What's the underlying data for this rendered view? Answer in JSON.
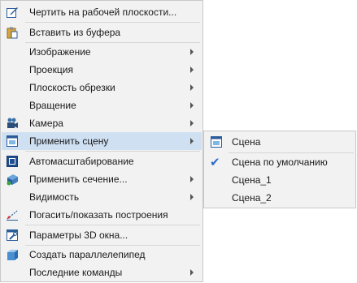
{
  "menu": {
    "items": [
      {
        "label": "Чертить на рабочей плоскости...",
        "icon": "draw-on-plane-icon",
        "submenu": false
      },
      {
        "label": "Вставить из буфера",
        "icon": "paste-clipboard-icon",
        "submenu": false
      },
      {
        "label": "Изображение",
        "icon": null,
        "submenu": true
      },
      {
        "label": "Проекция",
        "icon": null,
        "submenu": true
      },
      {
        "label": "Плоскость обрезки",
        "icon": null,
        "submenu": true
      },
      {
        "label": "Вращение",
        "icon": null,
        "submenu": true
      },
      {
        "label": "Камера",
        "icon": "camera-icon",
        "submenu": true
      },
      {
        "label": "Применить сцену",
        "icon": "scene-icon",
        "submenu": true,
        "highlighted": true
      },
      {
        "label": "Автомасштабирование",
        "icon": "auto-scale-icon",
        "submenu": false
      },
      {
        "label": "Применить сечение...",
        "icon": "section-icon",
        "submenu": true
      },
      {
        "label": "Видимость",
        "icon": null,
        "submenu": true
      },
      {
        "label": "Погасить/показать построения",
        "icon": "hide-show-constructions-icon",
        "submenu": false
      },
      {
        "label": "Параметры 3D окна...",
        "icon": "window-3d-params-icon",
        "submenu": false
      },
      {
        "label": "Создать параллелепипед",
        "icon": "cuboid-icon",
        "submenu": false
      },
      {
        "label": "Последние команды",
        "icon": null,
        "submenu": true
      }
    ]
  },
  "submenu": {
    "items": [
      {
        "label": "Сцена",
        "icon": "scene-icon"
      },
      {
        "label": "Сцена по умолчанию",
        "checked": true
      },
      {
        "label": "Сцена_1"
      },
      {
        "label": "Сцена_2"
      }
    ]
  },
  "colors": {
    "menu_bg": "#f2f2f2",
    "highlight_bg": "#cfe0f3",
    "check": "#2a6cc6"
  }
}
